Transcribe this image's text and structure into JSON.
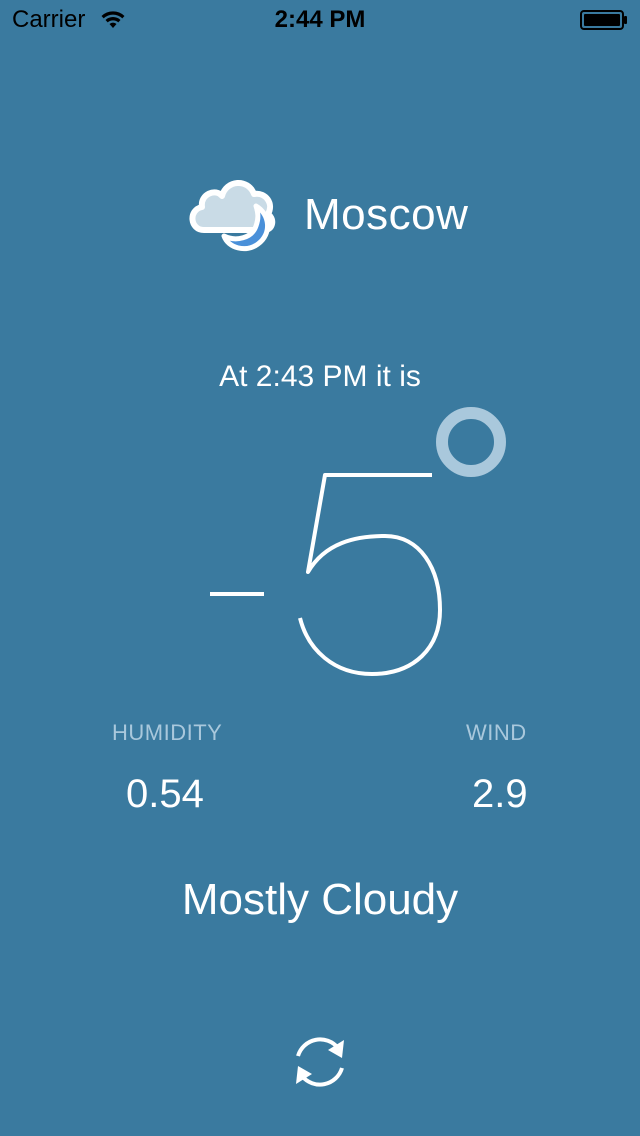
{
  "status_bar": {
    "carrier": "Carrier",
    "time": "2:44 PM"
  },
  "header": {
    "city": "Moscow",
    "weather_icon": "cloud-moon-icon"
  },
  "observation": {
    "time_text": "At 2:43 PM it is"
  },
  "temperature": {
    "value": "-5",
    "unit_symbol": "°"
  },
  "stats": {
    "humidity_label": "HUMIDITY",
    "humidity_value": "0.54",
    "wind_label": "WIND",
    "wind_value": "2.9"
  },
  "condition": "Mostly Cloudy",
  "actions": {
    "refresh_icon": "refresh-icon"
  },
  "colors": {
    "background": "#3a7a9f",
    "text": "#ffffff",
    "muted_label": "#a9c8dc",
    "moon": "#4a90d9",
    "cloud": "#c9dbe6"
  }
}
